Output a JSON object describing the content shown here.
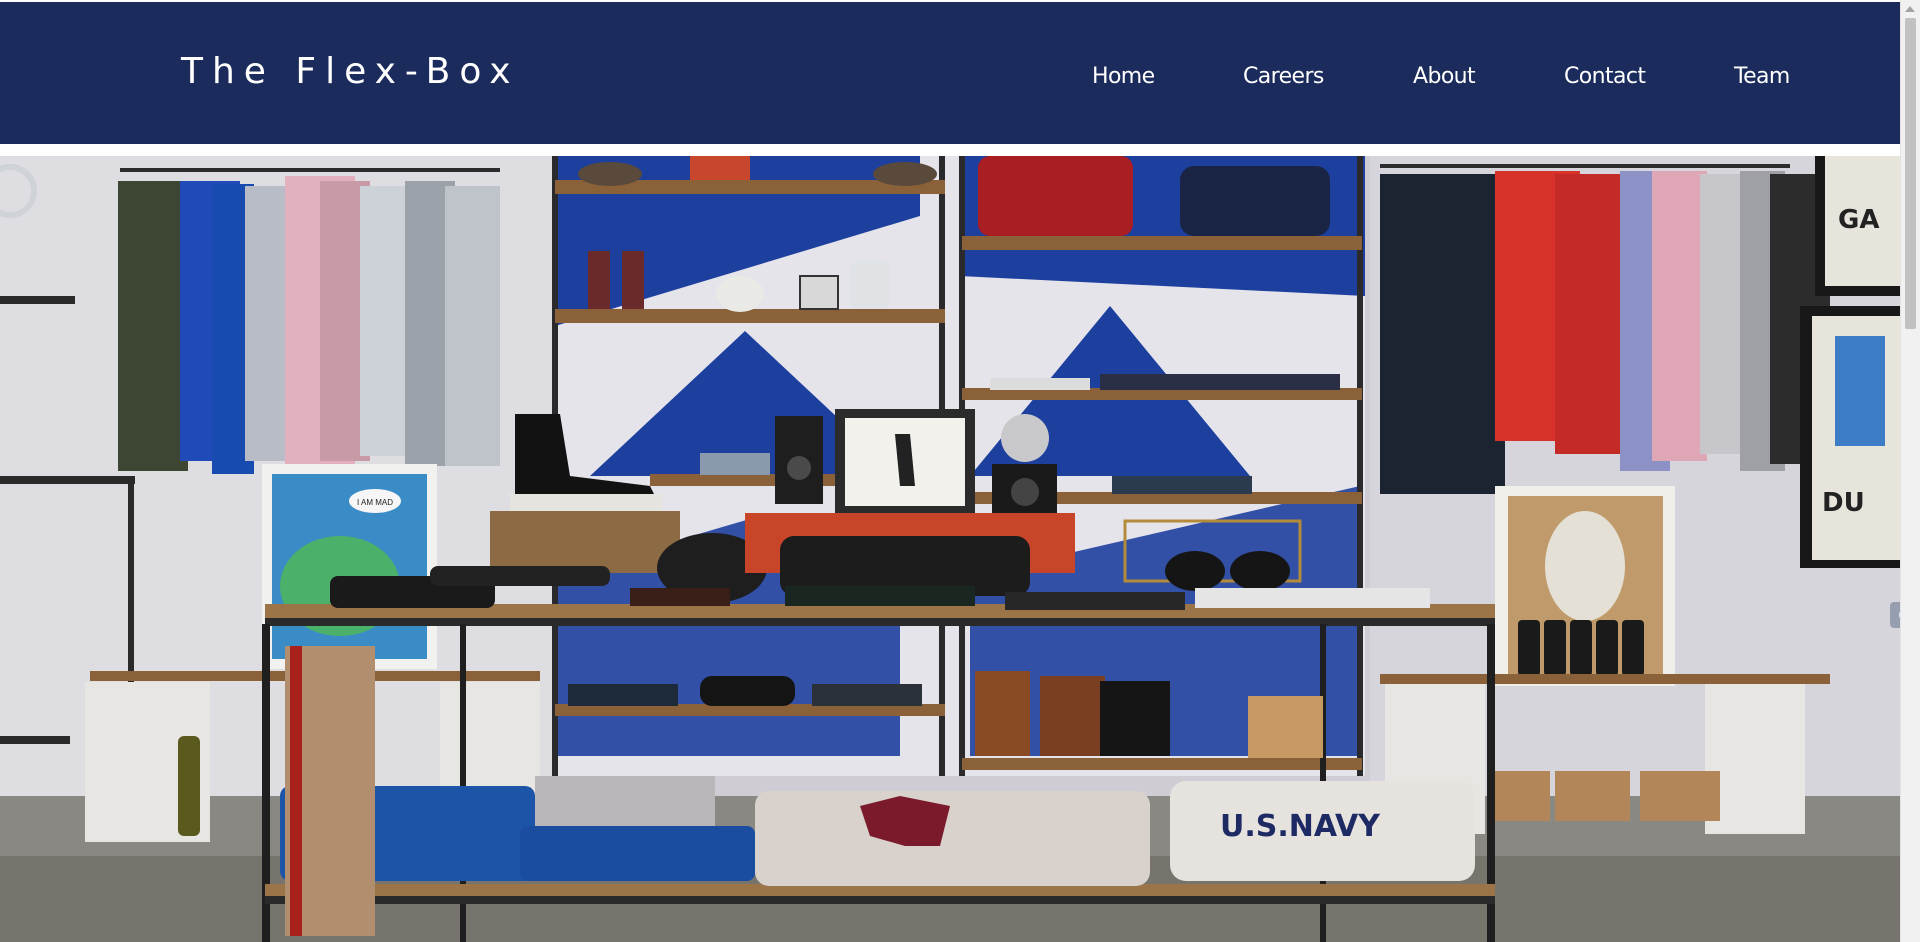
{
  "site": {
    "logo": "The Flex-Box"
  },
  "nav": {
    "items": [
      {
        "label": "Home"
      },
      {
        "label": "Careers"
      },
      {
        "label": "About"
      },
      {
        "label": "Contact"
      },
      {
        "label": "Team"
      }
    ]
  },
  "hero": {
    "image_subject": "clothing store interior with shelves, hanging shirts and folded sweaters",
    "sweater_right_text": "U.S.NAVY",
    "poster_text": "I AM MAD",
    "frame_text_1": "GA",
    "frame_text_2": "DU"
  },
  "colors": {
    "nav_bg": "#1b2b5b",
    "nav_text": "#ffffff",
    "wall_blue": "#1d3f9e",
    "shelf_wood": "#8a6138"
  },
  "icons": {
    "scroll_up": "scroll-up-arrow-icon",
    "side_widget": "side-widget-icon"
  }
}
